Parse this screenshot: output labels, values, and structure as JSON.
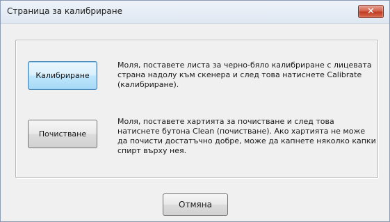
{
  "window": {
    "title": "Страница за калибриране",
    "close_glyph": "✕",
    "close_icon": "close-icon"
  },
  "calibration": {
    "button_label": "Калибриране",
    "description": "Моля, поставете листа за черно-бяло калибриране с лицевата страна надолу към скенера и след това натиснете Calibrate (калибриране)."
  },
  "cleaning": {
    "button_label": "Почистване",
    "description": "Моля, поставете хартията за почистване и след това натиснете бутона Clean (почистване). Ако хартията не може да почисти достатъчно добре, може да капнете няколко капки спирт върху нея."
  },
  "footer": {
    "cancel_label": "Отмяна"
  },
  "colors": {
    "close_button": "#c8452c",
    "default_button_border": "#3c7fb1",
    "dialog_background": "#f0f0f0"
  }
}
